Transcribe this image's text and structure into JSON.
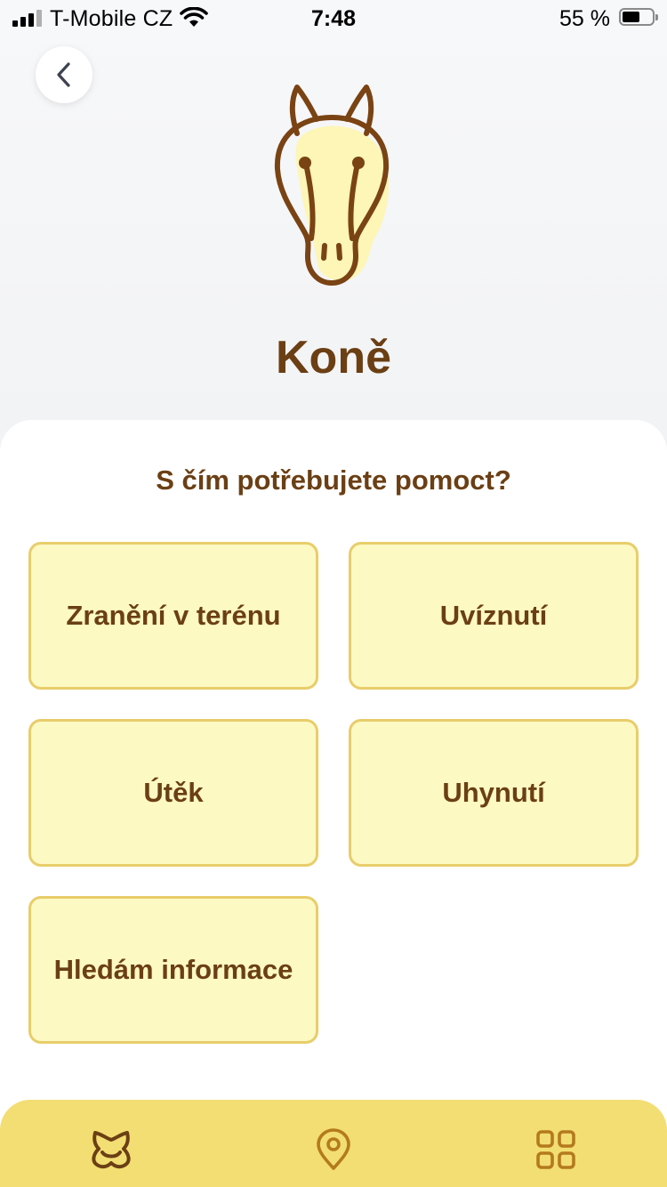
{
  "status_bar": {
    "carrier": "T-Mobile CZ",
    "time": "7:48",
    "battery": "55 %"
  },
  "header": {
    "back_icon": "chevron-left-icon",
    "animal_icon": "horse-head-icon",
    "title": "Koně"
  },
  "panel": {
    "question": "S čím potřebujete pomoct?",
    "options": [
      {
        "label": "Zranění v terénu"
      },
      {
        "label": "Uvíznutí"
      },
      {
        "label": "Útěk"
      },
      {
        "label": "Uhynutí"
      },
      {
        "label": "Hledám informace"
      }
    ]
  },
  "tab_bar": {
    "items": [
      {
        "icon": "animal-head-icon"
      },
      {
        "icon": "map-pin-icon"
      },
      {
        "icon": "grid-icon"
      }
    ]
  },
  "colors": {
    "brand_brown": "#6b3f14",
    "option_fill": "#fdf9c3",
    "option_border": "#e8cd6a",
    "tab_bar": "#f2de72",
    "icon_stroke": "#b47a1e"
  }
}
